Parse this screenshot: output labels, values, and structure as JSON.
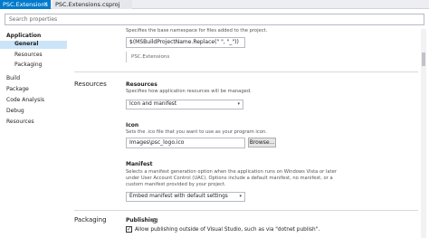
{
  "tabs": [
    {
      "label": "PSC.Extensions",
      "active": true
    },
    {
      "label": "PSC.Extensions.csproj",
      "active": false
    }
  ],
  "search": {
    "placeholder": "Search properties"
  },
  "nav": {
    "application": "Application",
    "general": "General",
    "resources": "Resources",
    "packaging": "Packaging",
    "build": "Build",
    "package": "Package",
    "code_analysis": "Code Analysis",
    "debug": "Debug",
    "resources_root": "Resources"
  },
  "namespace": {
    "description": "Specifies the base namespace for files added to the project.",
    "value": "$(MSBuildProjectName.Replace(\" \", \"_\"))",
    "preview": "PSC.Extensions"
  },
  "resources_section": {
    "heading": "Resources",
    "title": "Resources",
    "description": "Specifies how application resources will be managed.",
    "selected": "Icon and manifest"
  },
  "icon": {
    "title": "Icon",
    "description": "Sets the .ico file that you want to use as your program icon.",
    "value": "Images\\psc_logo.ico",
    "browse": "Browse..."
  },
  "manifest": {
    "title": "Manifest",
    "description_1": "Selects a manifest generation option when the application runs on Windows Vista or later",
    "description_2": "under User Account Control (UAC). Options include a default manifest, no manifest, or a",
    "description_3": "custom manifest provided by your project.",
    "selected": "Embed manifest with default settings"
  },
  "packaging_section": {
    "heading": "Packaging",
    "title": "Publishing",
    "help_icon": "?",
    "checkbox_checked": true,
    "checkbox_mark": "✓",
    "checkbox_label": "Allow publishing outside of Visual Studio, such as via \"dotnet publish\"."
  },
  "icons": {
    "close": "×",
    "dropdown": "▾"
  }
}
